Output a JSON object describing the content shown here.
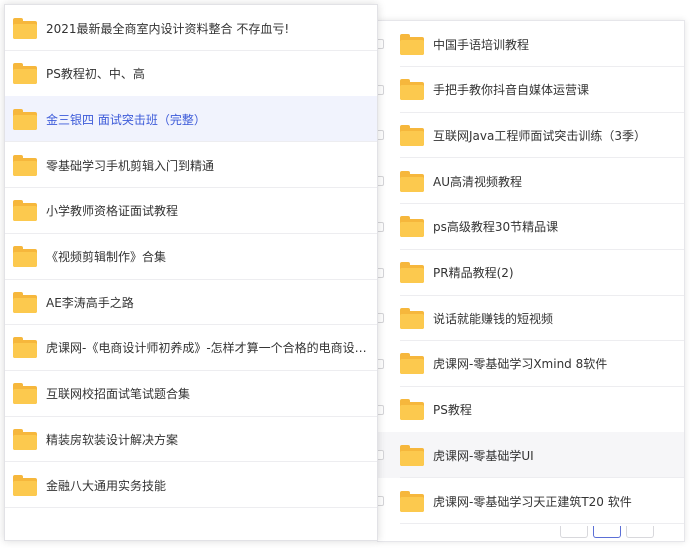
{
  "left_panel": {
    "items": [
      {
        "label": "2021最新最全商室内设计资料整合 不存血亏!",
        "state": "normal"
      },
      {
        "label": "PS教程初、中、高",
        "state": "normal"
      },
      {
        "label": "金三银四 面试突击班（完整）",
        "state": "selected"
      },
      {
        "label": "零基础学习手机剪辑入门到精通",
        "state": "normal"
      },
      {
        "label": "小学教师资格证面试教程",
        "state": "normal"
      },
      {
        "label": "《视频剪辑制作》合集",
        "state": "normal"
      },
      {
        "label": "AE李涛高手之路",
        "state": "normal"
      },
      {
        "label": "虎课网-《电商设计师初养成》-怎样才算一个合格的电商设计师?",
        "state": "normal"
      },
      {
        "label": "互联网校招面试笔试题合集",
        "state": "normal"
      },
      {
        "label": "精装房软装设计解决方案",
        "state": "normal"
      },
      {
        "label": "金融八大通用实务技能",
        "state": "normal"
      }
    ]
  },
  "right_panel": {
    "items": [
      {
        "label": "中国手语培训教程",
        "state": "normal"
      },
      {
        "label": "手把手教你抖音自媒体运营课",
        "state": "normal"
      },
      {
        "label": "互联网Java工程师面试突击训练（3季）",
        "state": "normal"
      },
      {
        "label": "AU高清视频教程",
        "state": "normal"
      },
      {
        "label": "ps高级教程30节精品课",
        "state": "normal"
      },
      {
        "label": "PR精品教程(2)",
        "state": "normal"
      },
      {
        "label": "说话就能赚钱的短视频",
        "state": "normal"
      },
      {
        "label": "虎课网-零基础学习Xmind 8软件",
        "state": "normal"
      },
      {
        "label": "PS教程",
        "state": "normal"
      },
      {
        "label": "虎课网-零基础学UI",
        "state": "hover"
      },
      {
        "label": "虎课网-零基础学习天正建筑T20 软件",
        "state": "normal"
      }
    ]
  },
  "colors": {
    "folder_front": "#fcc94e",
    "folder_back": "#f6b73c",
    "selected_bg": "#f1f3fd",
    "selected_text": "#3d5bd9",
    "text": "#333333"
  },
  "icons": {
    "folder": "folder-icon",
    "checkbox": "checkbox"
  }
}
